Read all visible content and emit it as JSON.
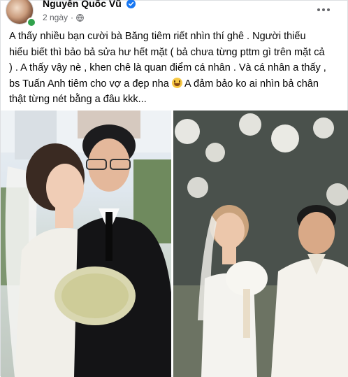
{
  "post": {
    "author": "Nguyễn Quốc Vũ",
    "time": "2 ngày",
    "text_lines": [
      "A thấy nhiều bạn cười bà Băng tiêm riết nhìn thí ghê . Người thiếu",
      "hiểu biết thì bảo bả sửa hư hết mặt ( bả chưa từng pttm gì trên mặt cả",
      ") . A thấy vậy nè , khen chê là quan điểm cá nhân . Và cá nhân a thấy ,",
      "bs Tuấn Anh tiêm cho vợ a đẹp nha",
      " A đảm bảo ko ai nhìn bả chân",
      "thật từng nét bằng a đâu kkk..."
    ]
  },
  "icons": {
    "verified": "verified-badge-icon",
    "privacy": "globe-icon",
    "more": "more-options-icon",
    "emoji": "grinning-face-emoji"
  },
  "colors": {
    "verified": "#1877f2",
    "secondary_text": "#65676b",
    "online": "#31a24c"
  }
}
